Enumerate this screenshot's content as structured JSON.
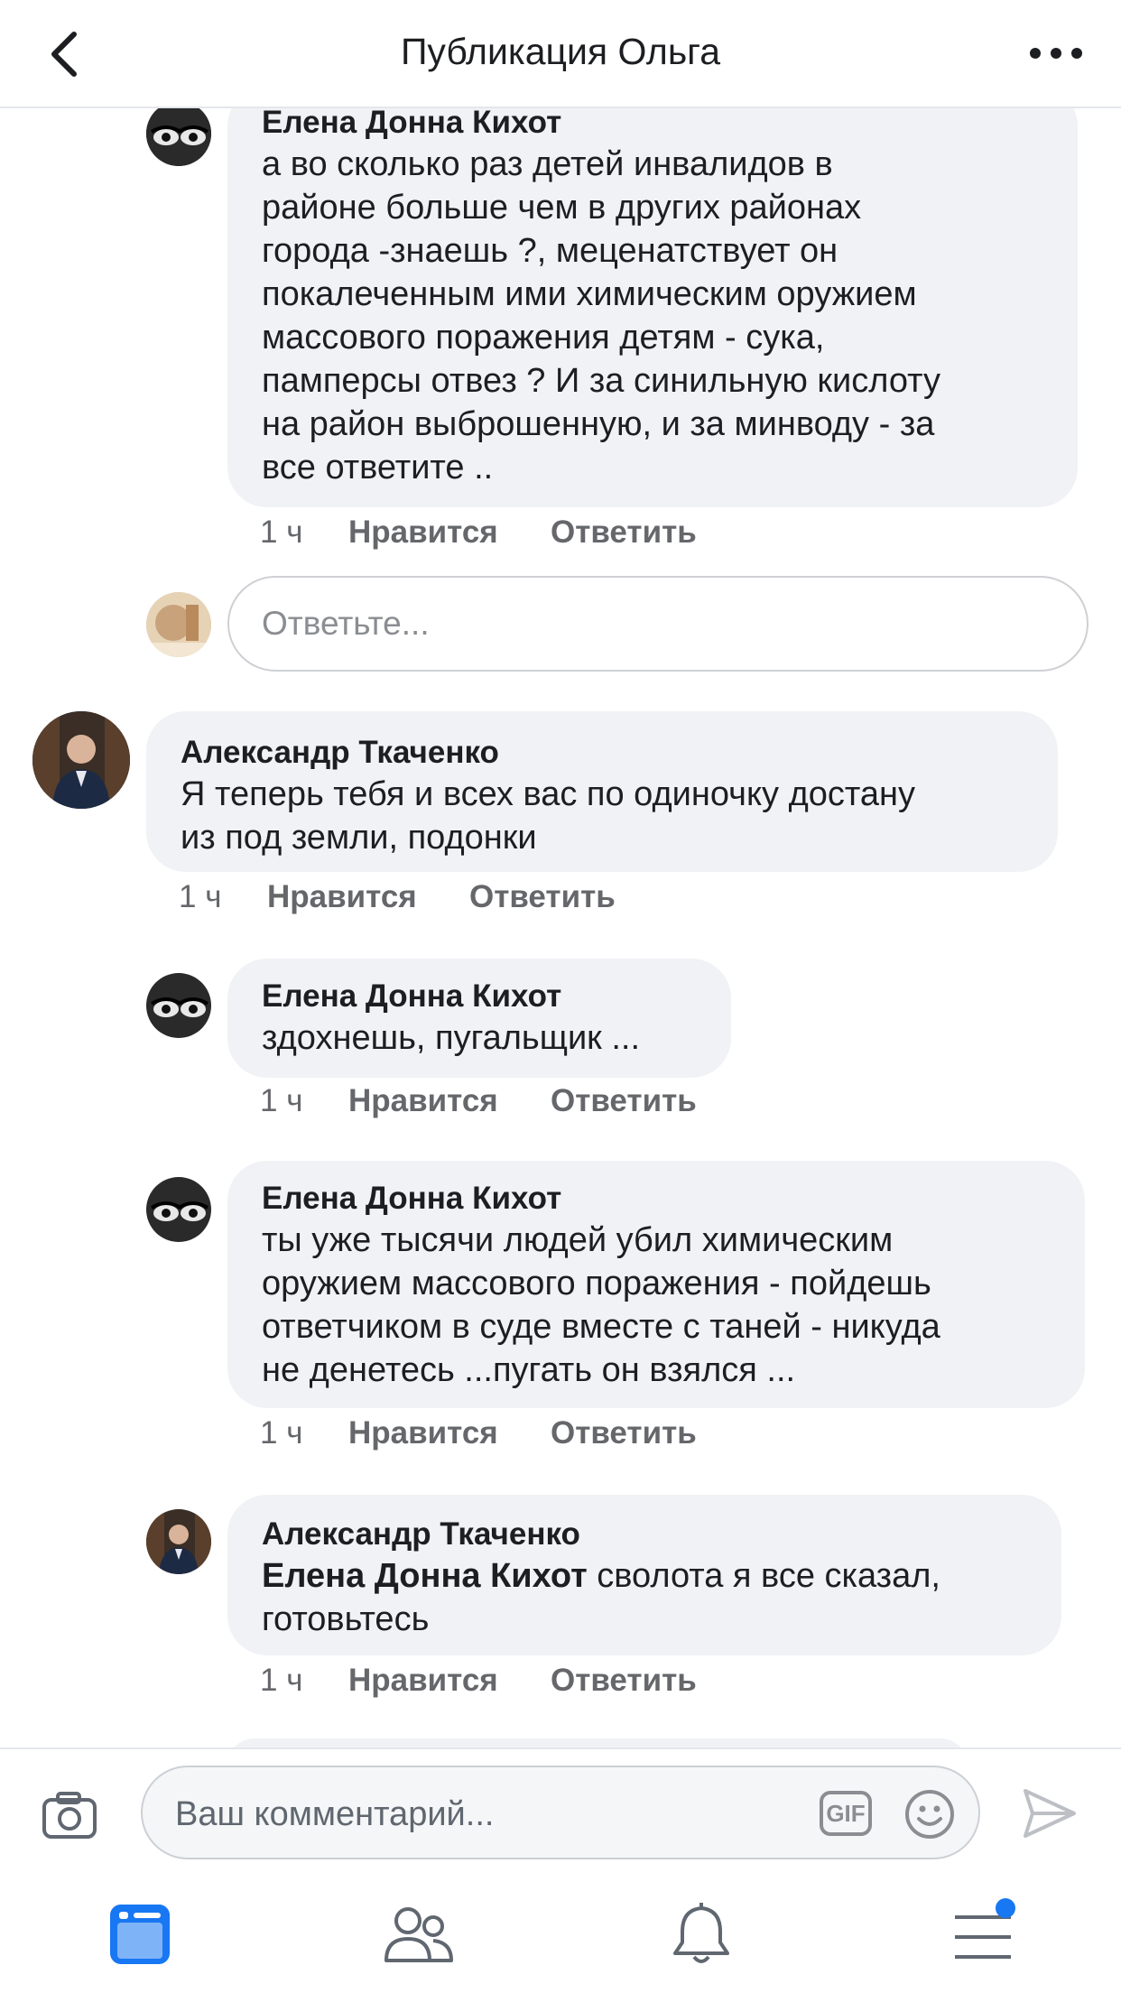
{
  "header": {
    "title": "Публикация Ольга"
  },
  "comments": [
    {
      "name": "Елена Донна Кихот",
      "lines": [
        "а во сколько раз  детей инвалидов в",
        "районе больше чем в других районах",
        "города -знаешь ?, меценатствует он",
        "покалеченным ими химическим оружием",
        "массового поражения детям - сука,",
        "памперсы отвез ? И за синильную кислоту",
        "на район выброшенную, и за минводу - за",
        "все ответите .."
      ],
      "time": "1 ч",
      "like": "Нравится",
      "reply": "Ответить"
    },
    {
      "name": "Александр Ткаченко",
      "lines": [
        "Я теперь тебя и всех вас по одиночку достану",
        "из под земли, подонки"
      ],
      "time": "1 ч",
      "like": "Нравится",
      "reply": "Ответить"
    },
    {
      "name": "Елена Донна Кихот",
      "lines": [
        "здохнешь, пугальщик ..."
      ],
      "time": "1 ч",
      "like": "Нравится",
      "reply": "Ответить"
    },
    {
      "name": "Елена Донна Кихот",
      "lines": [
        "ты уже тысячи людей убил химическим",
        "оружием массового поражения - пойдешь",
        "ответчиком в суде вместе с таней - никуда",
        "не денетесь ...пугать он взялся  ..."
      ],
      "time": "1 ч",
      "like": "Нравится",
      "reply": "Ответить"
    },
    {
      "name": "Александр Ткаченко",
      "tag": "Елена Донна Кихот",
      "line1_rest": " сволота я все сказал,",
      "line2": "готовьтесь",
      "time": "1 ч",
      "like": "Нравится",
      "reply": "Ответить"
    }
  ],
  "reply_box": {
    "placeholder": "Ответьте..."
  },
  "composer": {
    "placeholder": "Ваш комментарий...",
    "gif_label": "GIF"
  },
  "colors": {
    "accent": "#1877f2",
    "bubble": "#f0f2f5",
    "meta": "#65676b"
  },
  "tabbar": {
    "items": [
      "news-feed-icon",
      "friends-icon",
      "notifications-icon",
      "menu-icon"
    ],
    "active": "news-feed-icon",
    "menu_badge": true
  }
}
